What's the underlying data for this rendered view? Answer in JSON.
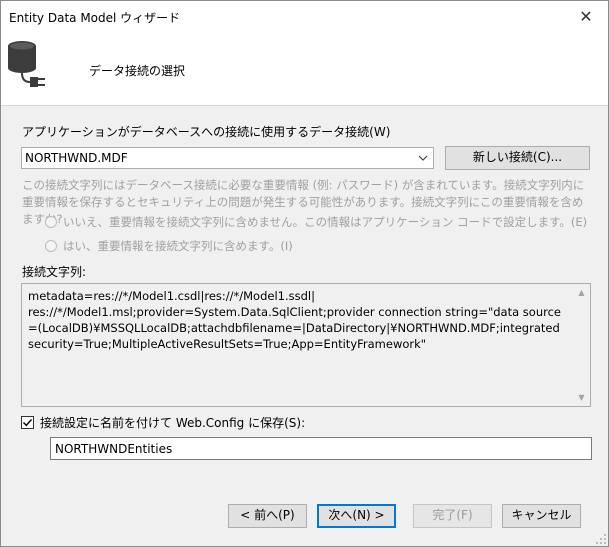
{
  "window": {
    "title": "Entity Data Model ウィザード",
    "close_glyph": "✕"
  },
  "header": {
    "icon": "database-plug-icon",
    "title": "データ接続の選択"
  },
  "connection": {
    "label": "アプリケーションがデータベースへの接続に使用するデータ接続(W)",
    "selected": "NORTHWND.MDF",
    "new_button": "新しい接続(C)..."
  },
  "sensitive": {
    "note": "この接続文字列にはデータベース接続に必要な重要情報 (例: パスワード) が含まれています。接続文字列内に重要情報を保存するとセキュリティ上の問題が発生する可能性があります。接続文字列にこの重要情報を含めますか?",
    "option_no": "いいえ、重要情報を接続文字列に含めません。この情報はアプリケーション コードで設定します。(E)",
    "option_yes": "はい、重要情報を接続文字列に含めます。(I)"
  },
  "connection_string": {
    "label": "接続文字列:",
    "value": "metadata=res://*/Model1.csdl|res://*/Model1.ssdl|\nres://*/Model1.msl;provider=System.Data.SqlClient;provider connection string=\"data source=(LocalDB)¥MSSQLLocalDB;attachdbfilename=|DataDirectory|¥NORTHWND.MDF;integrated security=True;MultipleActiveResultSets=True;App=EntityFramework\""
  },
  "save": {
    "checked": true,
    "label": "接続設定に名前を付けて Web.Config に保存(S):",
    "name_value": "NORTHWNDEntities"
  },
  "buttons": {
    "back": "< 前へ(P)",
    "next": "次へ(N) >",
    "finish": "完了(F)",
    "cancel": "キャンセル"
  }
}
